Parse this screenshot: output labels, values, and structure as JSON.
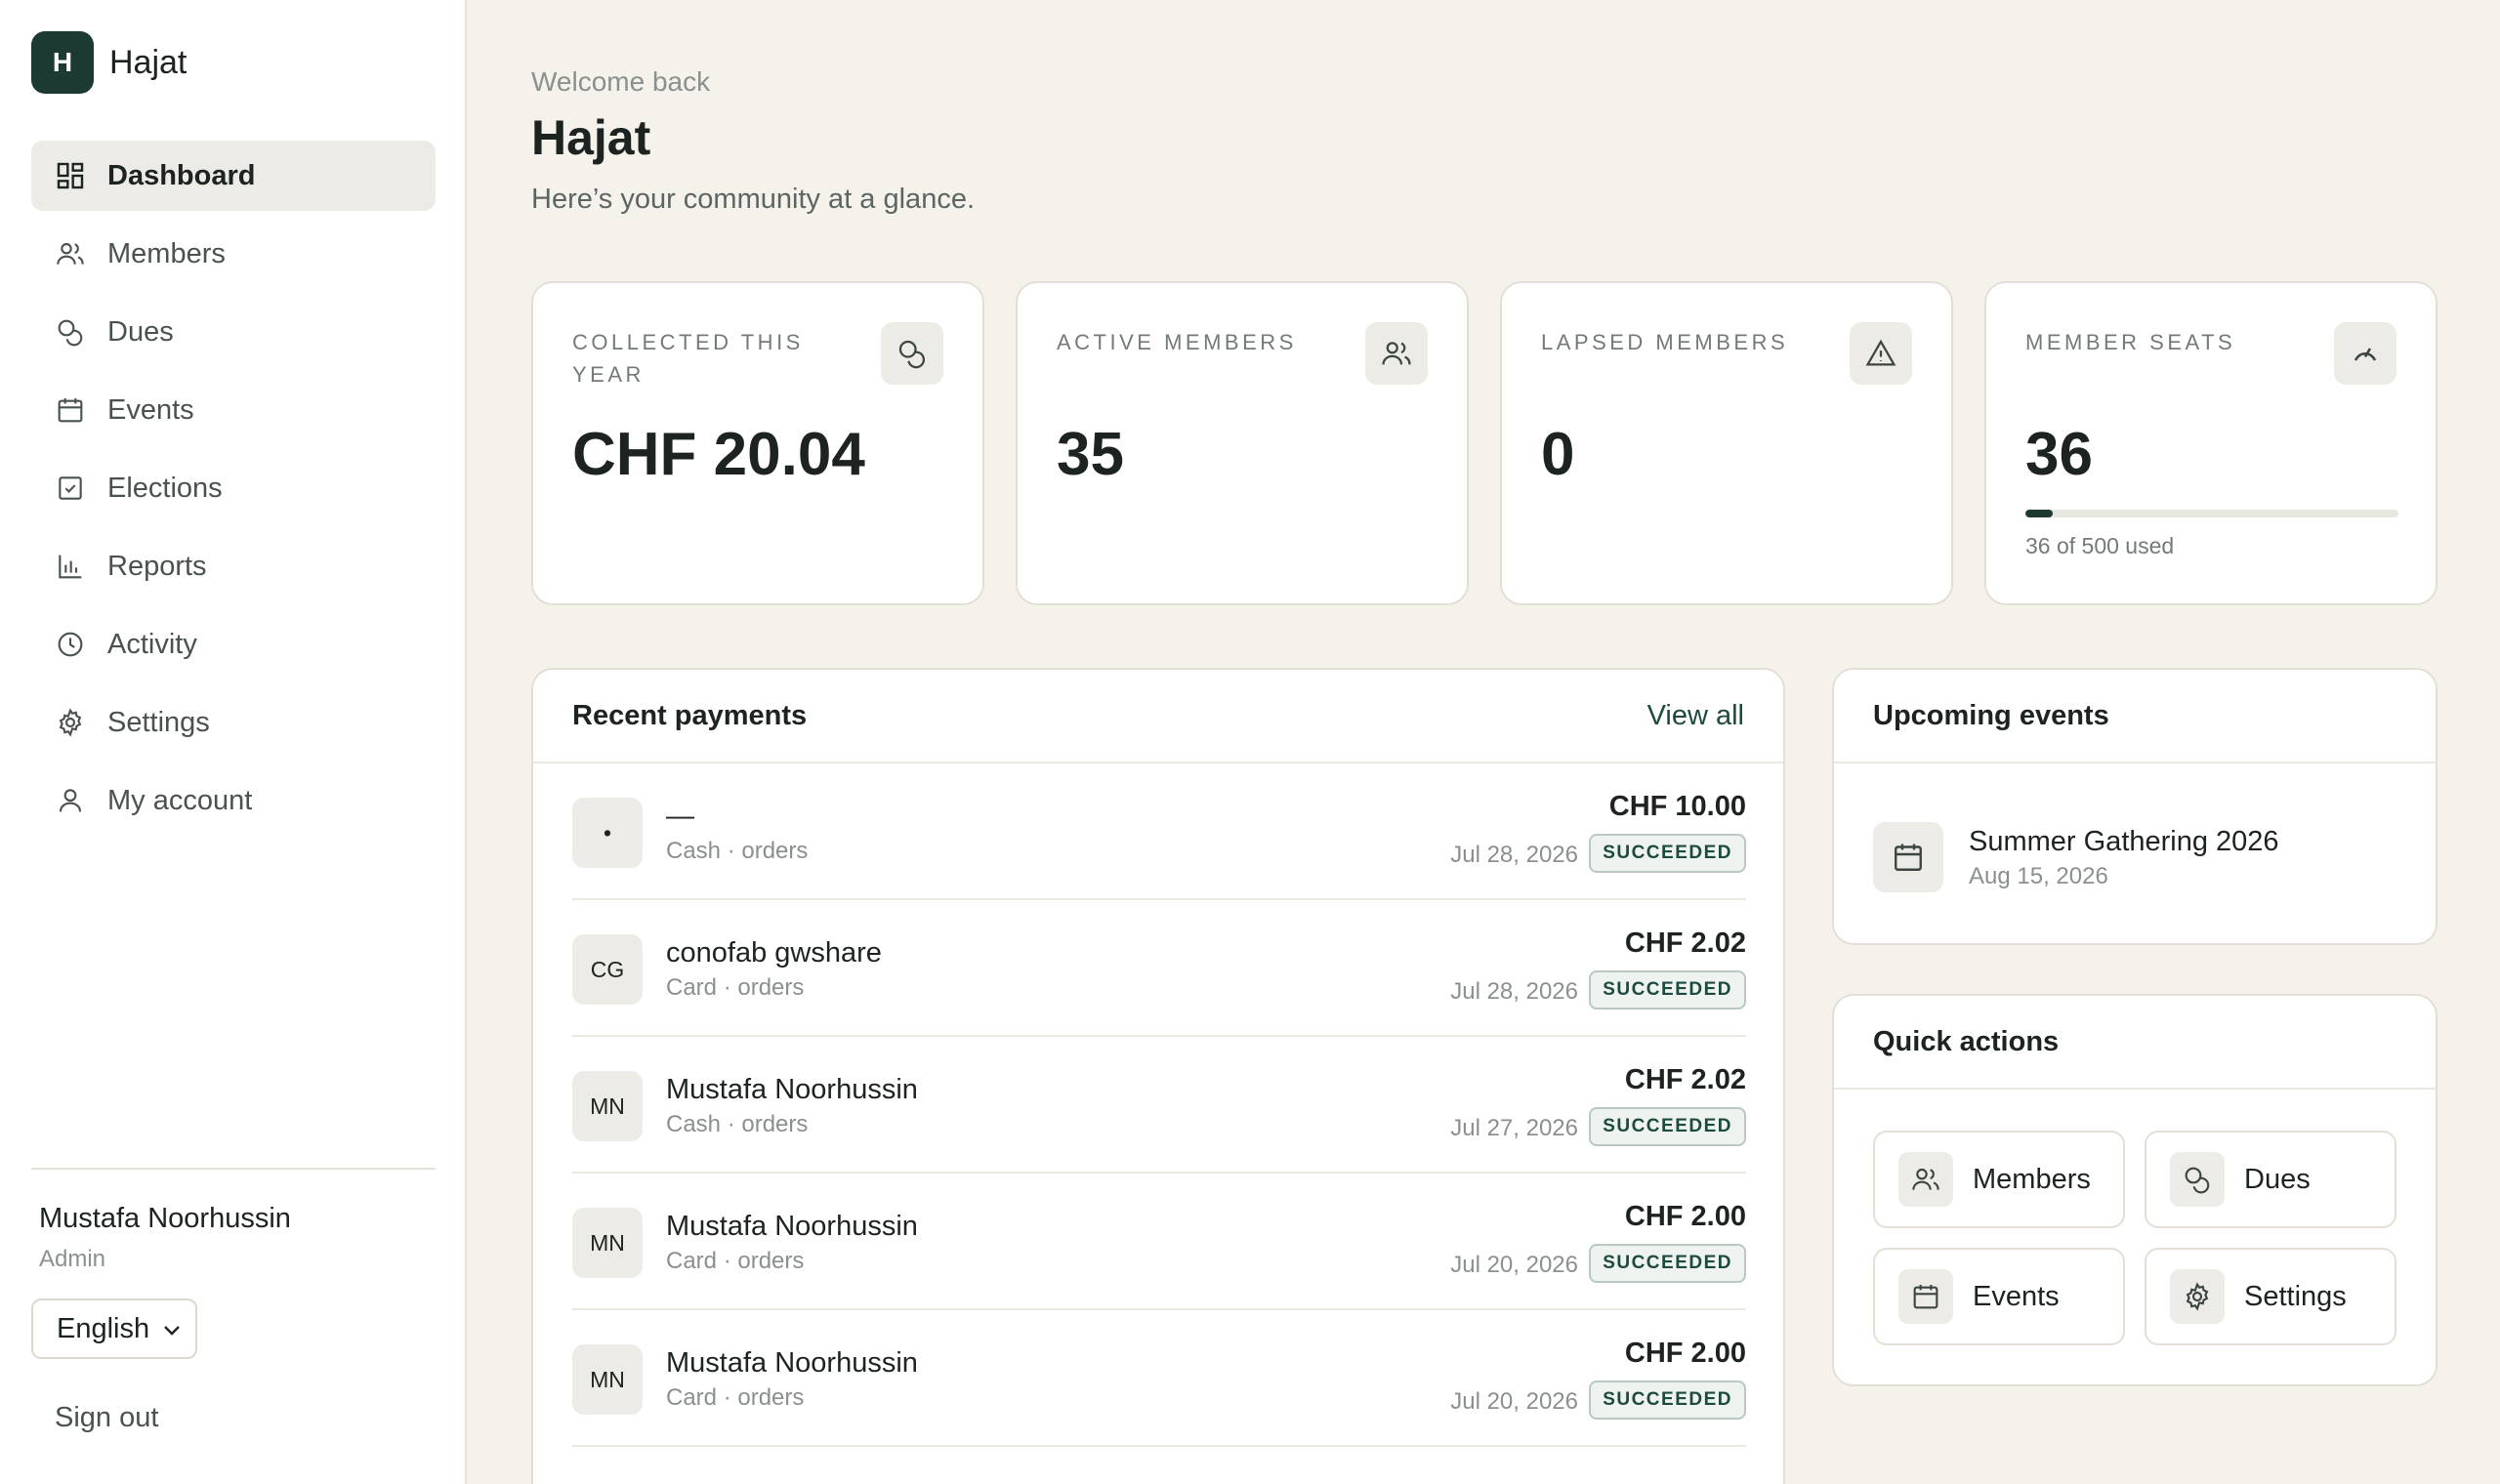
{
  "brand": {
    "initial": "H",
    "name": "Hajat"
  },
  "sidebar": {
    "items": [
      {
        "label": "Dashboard",
        "icon": "dashboard-icon",
        "active": true
      },
      {
        "label": "Members",
        "icon": "members-icon"
      },
      {
        "label": "Dues",
        "icon": "coins-icon"
      },
      {
        "label": "Events",
        "icon": "calendar-icon"
      },
      {
        "label": "Elections",
        "icon": "ballot-check-icon"
      },
      {
        "label": "Reports",
        "icon": "bar-chart-icon"
      },
      {
        "label": "Activity",
        "icon": "clock-icon"
      },
      {
        "label": "Settings",
        "icon": "gear-icon"
      },
      {
        "label": "My account",
        "icon": "user-icon"
      }
    ],
    "user": {
      "name": "Mustafa Noorhussin",
      "role": "Admin"
    },
    "language": "English",
    "sign_out": "Sign out"
  },
  "header": {
    "welcome": "Welcome back",
    "title": "Hajat",
    "subtitle": "Here’s your community at a glance."
  },
  "stats": [
    {
      "label": "COLLECTED THIS YEAR",
      "value": "CHF 20.04",
      "icon": "coins-icon"
    },
    {
      "label": "ACTIVE MEMBERS",
      "value": "35",
      "icon": "members-icon"
    },
    {
      "label": "LAPSED MEMBERS",
      "value": "0",
      "icon": "warning-icon"
    },
    {
      "label": "MEMBER SEATS",
      "value": "36",
      "icon": "gauge-icon",
      "used": 36,
      "total": 500,
      "footnote": "36 of 500 used"
    }
  ],
  "payments": {
    "title": "Recent payments",
    "view_all": "View all",
    "rows": [
      {
        "initials": "•",
        "name": "—",
        "meta": "Cash · orders",
        "amount": "CHF 10.00",
        "date": "Jul 28, 2026",
        "status": "SUCCEEDED"
      },
      {
        "initials": "CG",
        "name": "conofab gwshare",
        "meta": "Card · orders",
        "amount": "CHF 2.02",
        "date": "Jul 28, 2026",
        "status": "SUCCEEDED"
      },
      {
        "initials": "MN",
        "name": "Mustafa Noorhussin",
        "meta": "Cash · orders",
        "amount": "CHF 2.02",
        "date": "Jul 27, 2026",
        "status": "SUCCEEDED"
      },
      {
        "initials": "MN",
        "name": "Mustafa Noorhussin",
        "meta": "Card · orders",
        "amount": "CHF 2.00",
        "date": "Jul 20, 2026",
        "status": "SUCCEEDED"
      },
      {
        "initials": "MN",
        "name": "Mustafa Noorhussin",
        "meta": "Card · orders",
        "amount": "CHF 2.00",
        "date": "Jul 20, 2026",
        "status": "SUCCEEDED"
      }
    ]
  },
  "events": {
    "title": "Upcoming events",
    "items": [
      {
        "title": "Summer Gathering 2026",
        "date": "Aug 15, 2026",
        "icon": "calendar-icon"
      }
    ]
  },
  "quick_actions": {
    "title": "Quick actions",
    "items": [
      {
        "label": "Members",
        "icon": "members-icon"
      },
      {
        "label": "Dues",
        "icon": "coins-icon"
      },
      {
        "label": "Events",
        "icon": "calendar-icon"
      },
      {
        "label": "Settings",
        "icon": "gear-icon"
      }
    ]
  },
  "colors": {
    "accent": "#1d3a32",
    "background": "#f5f2ec",
    "badge": "#1d4a3e"
  }
}
